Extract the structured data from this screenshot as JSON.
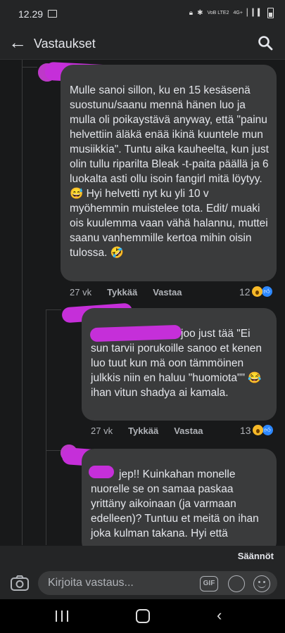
{
  "status_bar": {
    "time": "12.29",
    "network": "VoB LTE2",
    "network_type": "4G+"
  },
  "header": {
    "title": "Vastaukset",
    "back_icon": "arrow-left-icon",
    "search_icon": "search-icon"
  },
  "comments": [
    {
      "text": "Mulle sanoi sillon, ku en 15 kesäsenä suostunu/saanu mennä hänen luo ja mulla oli poikaystävä anyway, että \"painu helvettiin äläkä enää ikinä kuuntele mun musiikkia\". Tuntu aika kauheelta, kun just olin tullu riparilta Bleak -t-paita päällä ja 6 luokalta asti ollu isoin fangirl mitä löytyy. 😅 Hyi helvetti nyt ku yli 10 v myöhemmin muistelee tota. Edit/ muaki ois kuulemma vaan vähä halannu, muttei saanu vanhemmille kertoa mihin oisin tulossa. 🤣",
      "time": "27 vk",
      "like_label": "Tykkää",
      "reply_label": "Vastaa",
      "reaction_count": "12"
    },
    {
      "text": "joo just tää \"Ei sun tarvii porukoille sanoo et kenen luo tuut kun mä oon tämmöinen julkkis niin en haluu \"huomiota\"\" 😂 ihan vitun shadya ai kamala.",
      "time": "27 vk",
      "like_label": "Tykkää",
      "reply_label": "Vastaa",
      "reaction_count": "13"
    },
    {
      "text": "jep!! Kuinkahan monelle nuorelle se on samaa paskaa yrittäny aikoinaan (ja varmaan edelleen)? Tuntuu et meitä on ihan joka kulman takana. Hyi että"
    }
  ],
  "rules_label": "Säännöt",
  "composer": {
    "placeholder": "Kirjoita vastaus...",
    "gif_label": "GIF"
  },
  "colors": {
    "background": "#18191a",
    "bubble": "#3a3b3c",
    "redaction": "#c52fd9",
    "like_blue": "#2d88ff",
    "wow_yellow": "#f7b928"
  }
}
